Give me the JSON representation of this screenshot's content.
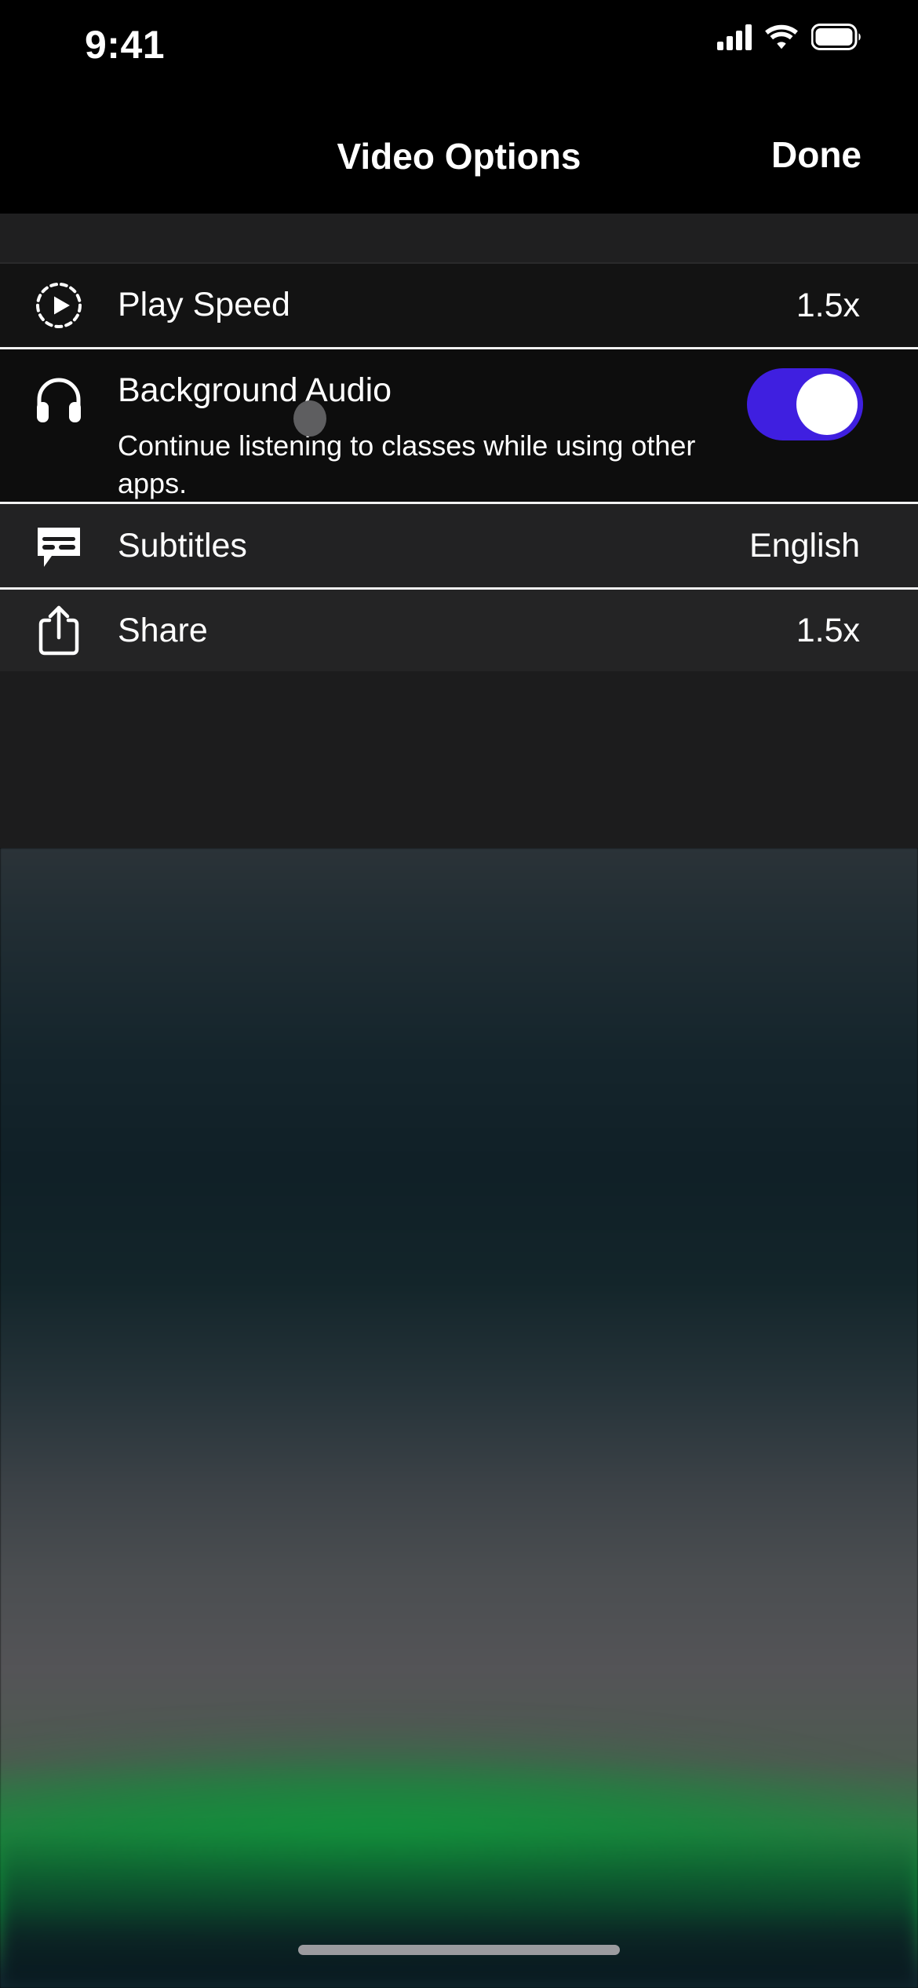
{
  "status_bar": {
    "time": "9:41",
    "icons": [
      "cellular-signal-icon",
      "wifi-icon",
      "battery-icon"
    ]
  },
  "header": {
    "title": "Video Options",
    "done_label": "Done"
  },
  "rows": [
    {
      "id": "play-speed",
      "icon": "play-circle-dashed-icon",
      "label": "Play Speed",
      "value": "1.5x",
      "control": "value"
    },
    {
      "id": "background-audio",
      "icon": "headphones-icon",
      "label": "Background Audio",
      "subtitle": "Continue listening to classes while using other apps.",
      "control": "toggle",
      "toggle_on": true
    },
    {
      "id": "subtitles",
      "icon": "subtitles-bubble-icon",
      "label": "Subtitles",
      "value": "English",
      "control": "value"
    },
    {
      "id": "share",
      "icon": "share-up-arrow-icon",
      "label": "Share",
      "value": "1.5x",
      "control": "value"
    }
  ],
  "colors": {
    "toggle_on": "#3f1fe0",
    "toggle_knob": "#ffffff",
    "sheet_background": "#1b1b1c",
    "divider": "#f2f2f2",
    "text_primary": "#ffffff",
    "touch_indicator": "#5e5e60",
    "home_indicator": "#9b9b9f"
  },
  "overlay": {
    "touch_indicator": "touch-point-indicator"
  },
  "home_indicator": {
    "label": "home-indicator"
  }
}
